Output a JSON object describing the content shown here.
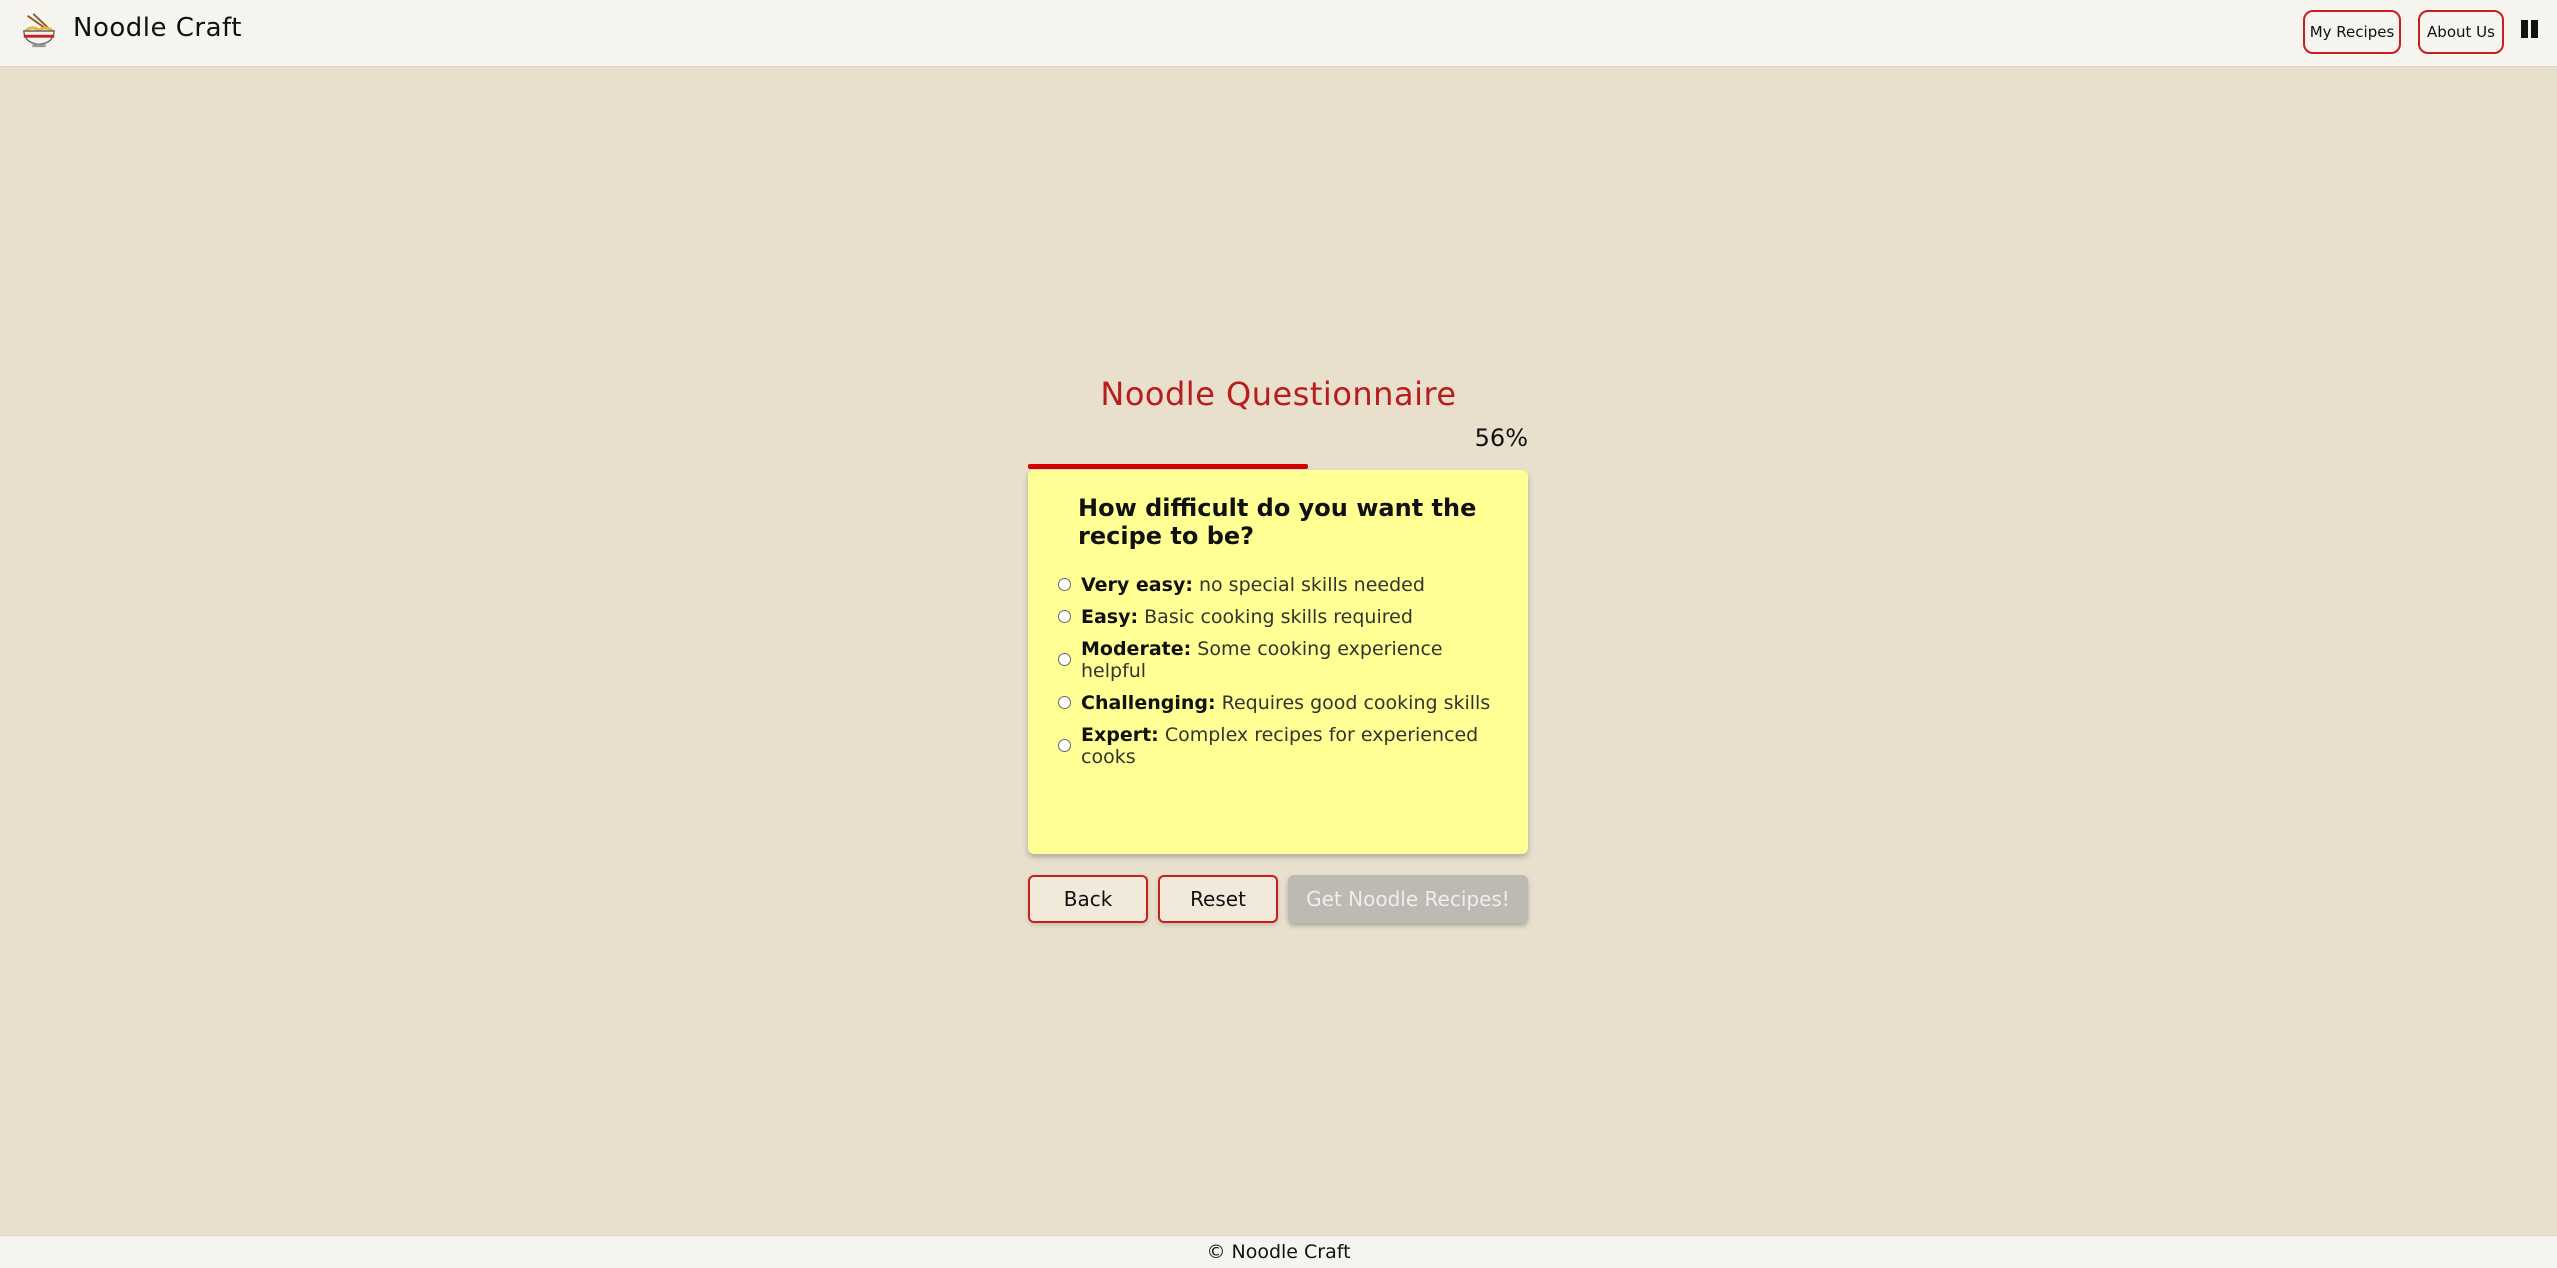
{
  "header": {
    "brand": "Noodle Craft",
    "nav": {
      "recipes": "My Recipes",
      "about": "About Us"
    }
  },
  "quiz": {
    "title": "Noodle Questionnaire",
    "progress_text": "56%",
    "progress": 0.56,
    "question": "How difficult do you want the recipe to be?",
    "options": [
      {
        "label": "Very easy:",
        "desc": "no special skills needed"
      },
      {
        "label": "Easy:",
        "desc": "Basic cooking skills required"
      },
      {
        "label": "Moderate:",
        "desc": "Some cooking experience helpful"
      },
      {
        "label": "Challenging:",
        "desc": "Requires good cooking skills"
      },
      {
        "label": "Expert:",
        "desc": "Complex recipes for experienced cooks"
      }
    ]
  },
  "actions": {
    "back": "Back",
    "reset": "Reset",
    "submit": "Get Noodle Recipes!"
  },
  "footer": {
    "text": "© Noodle Craft"
  },
  "colors": {
    "accent": "#c81e1e",
    "title": "#b91c1c",
    "card": "#ffff93",
    "background": "#e8e0cd"
  }
}
